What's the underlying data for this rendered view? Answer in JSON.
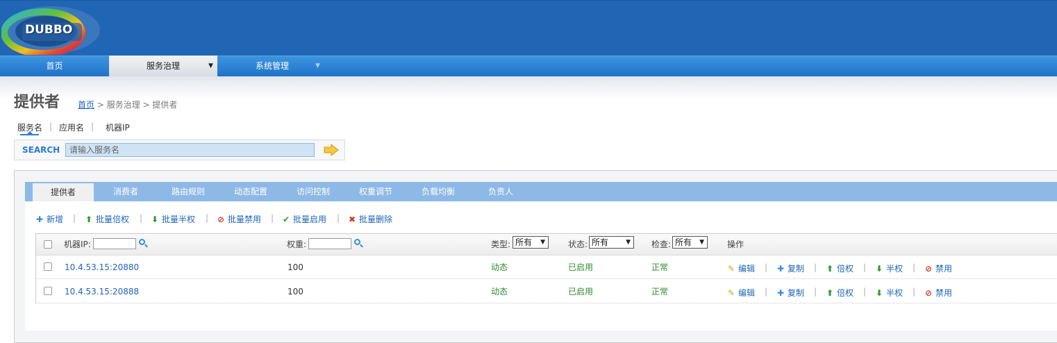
{
  "header": {
    "logo_text": "DUBBO"
  },
  "nav": {
    "items": [
      {
        "label": "首页"
      },
      {
        "label": "服务治理",
        "caret": "▼"
      },
      {
        "label": "系统管理",
        "caret": "▼"
      }
    ]
  },
  "page": {
    "title": "提供者",
    "breadcrumb": {
      "home": "首页",
      "rest": " > 服务治理 > 提供者"
    }
  },
  "search": {
    "tabs": [
      "服务名",
      "应用名",
      "机器IP"
    ],
    "separator": "|",
    "label": "SEARCH",
    "placeholder": "请输入服务名"
  },
  "tabs": [
    "提供者",
    "消费者",
    "路由规则",
    "动态配置",
    "访问控制",
    "权重调节",
    "负载均衡",
    "负责人"
  ],
  "toolbar": {
    "separator": "|",
    "actions": [
      {
        "label": "新增",
        "icon": "plus-icon",
        "color": "#3a8bd8"
      },
      {
        "label": "批量倍权",
        "icon": "arrow-up-icon",
        "color": "#2e9a2e"
      },
      {
        "label": "批量半权",
        "icon": "arrow-down-icon",
        "color": "#2e9a2e"
      },
      {
        "label": "批量禁用",
        "icon": "ban-icon",
        "color": "#d43a2a"
      },
      {
        "label": "批量启用",
        "icon": "check-icon",
        "color": "#2e9a2e"
      },
      {
        "label": "批量删除",
        "icon": "delete-icon",
        "color": "#d43a2a"
      }
    ]
  },
  "table": {
    "headers": {
      "ip": "机器IP:",
      "weight": "权重:",
      "type": "类型:",
      "status": "状态:",
      "check": "检查:",
      "ops": "操作"
    },
    "filters": {
      "type": "所有",
      "status": "所有",
      "check": "所有"
    },
    "rows": [
      {
        "ip": "10.4.53.15:20880",
        "weight": "100",
        "type": "动态",
        "status": "已启用",
        "check": "正常"
      },
      {
        "ip": "10.4.53.15:20888",
        "weight": "100",
        "type": "动态",
        "status": "已启用",
        "check": "正常"
      }
    ],
    "row_ops": [
      {
        "label": "编辑",
        "icon": "pencil-icon",
        "color": "#d8a020"
      },
      {
        "label": "复制",
        "icon": "plus-icon",
        "color": "#3a8bd8"
      },
      {
        "label": "倍权",
        "icon": "arrow-up-icon",
        "color": "#2e9a2e"
      },
      {
        "label": "半权",
        "icon": "arrow-down-icon",
        "color": "#2e9a2e"
      },
      {
        "label": "禁用",
        "icon": "ban-icon",
        "color": "#d43a2a"
      }
    ],
    "op_separator": "|"
  }
}
